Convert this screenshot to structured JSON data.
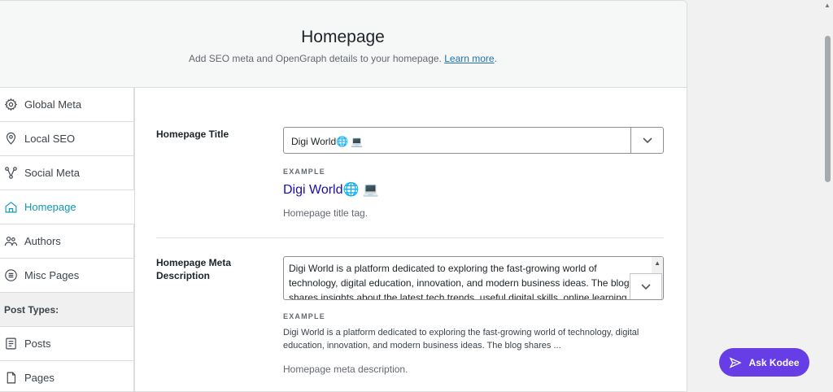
{
  "header": {
    "title": "Homepage",
    "subtitle": "Add SEO meta and OpenGraph details to your homepage.",
    "learn_more": "Learn more",
    "period": "."
  },
  "sidebar": {
    "items": [
      {
        "label": "Global Meta",
        "icon": "gear-icon"
      },
      {
        "label": "Local SEO",
        "icon": "location-pin-icon"
      },
      {
        "label": "Social Meta",
        "icon": "share-icon"
      },
      {
        "label": "Homepage",
        "icon": "home-icon",
        "active": true
      },
      {
        "label": "Authors",
        "icon": "users-icon"
      },
      {
        "label": "Misc Pages",
        "icon": "list-circle-icon"
      }
    ],
    "section_label": "Post Types:",
    "post_types": [
      {
        "label": "Posts",
        "icon": "document-icon"
      },
      {
        "label": "Pages",
        "icon": "page-icon"
      }
    ]
  },
  "fields": {
    "title": {
      "label": "Homepage Title",
      "value": "Digi World🌐 💻",
      "example_label": "EXAMPLE",
      "example": "Digi World🌐 💻",
      "help": "Homepage title tag."
    },
    "description": {
      "label_line1": "Homepage Meta",
      "label_line2": "Description",
      "value": "Digi World is a platform dedicated to exploring the fast-growing world of technology, digital education, innovation, and modern business ideas. The blog shares insights about the latest tech trends, useful digital skills, online learning",
      "example_label": "EXAMPLE",
      "example": "Digi World is a platform dedicated to exploring the fast-growing world of technology, digital education, innovation, and modern business ideas. The blog shares ...",
      "help": "Homepage meta description."
    }
  },
  "assistant": {
    "label": "Ask Kodee"
  },
  "colors": {
    "accent": "#0d99b6",
    "link": "#2271b1",
    "serp_title": "#1a0dab",
    "kodee": "#673de6"
  }
}
